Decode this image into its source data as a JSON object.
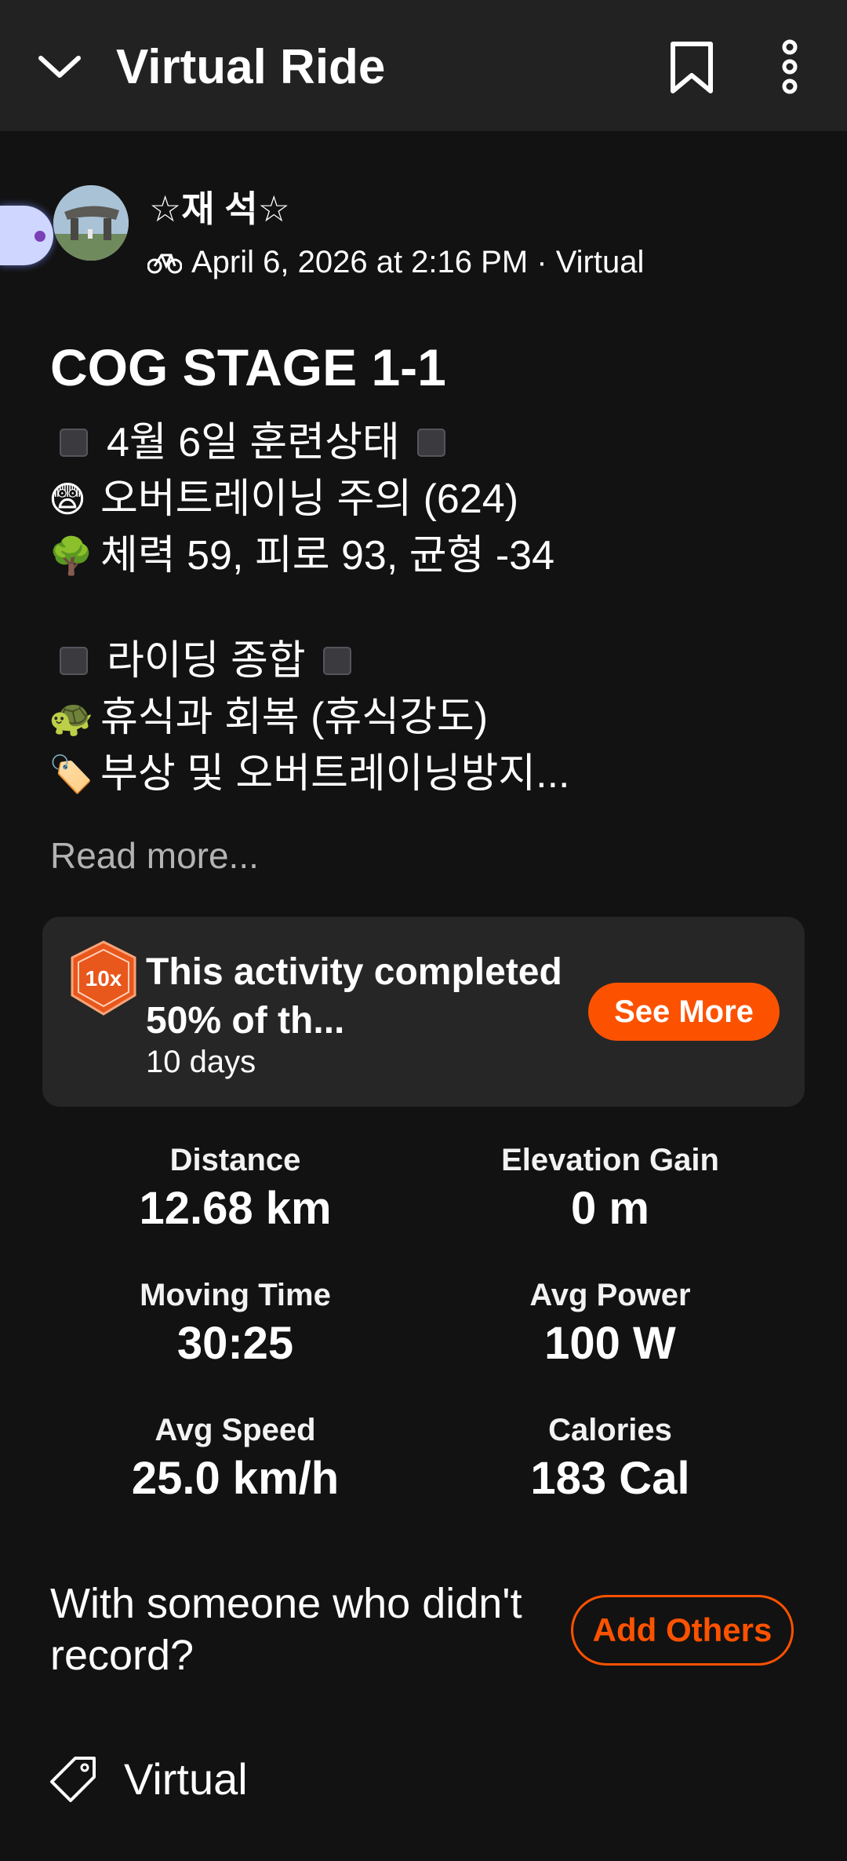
{
  "header": {
    "title": "Virtual Ride",
    "back_icon": "chevron-down-icon",
    "bookmark_icon": "bookmark-icon",
    "more_icon": "more-vertical-icon"
  },
  "athlete": {
    "name": "☆재 석☆",
    "meta": "April 6, 2026 at 2:16 PM · Virtual",
    "sport_icon": "bike-icon"
  },
  "activity": {
    "title": "COG STAGE 1-1",
    "description": [
      {
        "emoji": "",
        "text": "4월 6일 훈련상태",
        "boxed": true
      },
      {
        "emoji": "😨",
        "text": "오버트레이닝 주의 (624)",
        "boxed": false
      },
      {
        "emoji": "🌳",
        "text": "체력 59, 피로 93, 균형 -34",
        "boxed": false
      },
      {
        "emoji": "",
        "text": "",
        "boxed": false
      },
      {
        "emoji": "",
        "text": "라이딩 종합",
        "boxed": true
      },
      {
        "emoji": "🐢",
        "text": "휴식과 회복 (휴식강도)",
        "boxed": false
      },
      {
        "emoji": "🏷️",
        "text": "부상 및 오버트레이닝방지...",
        "boxed": false
      }
    ],
    "read_more": "Read more..."
  },
  "challenge_card": {
    "badge_icon": "10x-badge-icon",
    "title": "This activity completed 50% of th...",
    "subtitle": "10 days",
    "button": "See More",
    "accent": "#fc5200"
  },
  "stats": [
    {
      "label": "Distance",
      "value": "12.68 km"
    },
    {
      "label": "Elevation Gain",
      "value": "0 m"
    },
    {
      "label": "Moving Time",
      "value": "30:25"
    },
    {
      "label": "Avg Power",
      "value": "100 W"
    },
    {
      "label": "Avg Speed",
      "value": "25.0 km/h"
    },
    {
      "label": "Calories",
      "value": "183 Cal"
    }
  ],
  "with_others": {
    "text": "With someone who didn't record?",
    "button": "Add Others"
  },
  "tag": {
    "icon": "tag-icon",
    "label": "Virtual"
  }
}
